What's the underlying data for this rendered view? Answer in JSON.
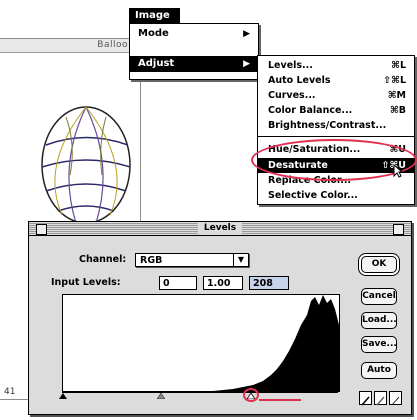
{
  "document": {
    "title": "Balloo",
    "footer": "41"
  },
  "menubar": {
    "image_menu": "Image"
  },
  "image_menu": {
    "items": [
      {
        "label": "Mode",
        "submenu": true
      },
      {
        "label": "Adjust",
        "submenu": true,
        "highlighted": true
      }
    ]
  },
  "adjust_menu": {
    "items": [
      {
        "label": "Levels...",
        "shortcut": "⌘L"
      },
      {
        "label": "Auto Levels",
        "shortcut": "⇧⌘L"
      },
      {
        "label": "Curves...",
        "shortcut": "⌘M"
      },
      {
        "label": "Color Balance...",
        "shortcut": "⌘B"
      },
      {
        "label": "Brightness/Contrast...",
        "shortcut": ""
      },
      {
        "label": "Hue/Saturation...",
        "shortcut": "⌘U"
      },
      {
        "label": "Desaturate",
        "shortcut": "⇧⌘U",
        "highlighted": true
      },
      {
        "label": "Replace Color...",
        "shortcut": ""
      },
      {
        "label": "Selective Color...",
        "shortcut": ""
      }
    ]
  },
  "levels_dialog": {
    "title": "Levels",
    "channel_label": "Channel:",
    "channel_value": "RGB",
    "input_levels_label": "Input Levels:",
    "input_black": "0",
    "input_gamma": "1.00",
    "input_white": "208",
    "buttons": {
      "ok": "OK",
      "cancel": "Cancel",
      "load": "Load...",
      "save": "Save...",
      "auto": "Auto"
    }
  },
  "annotation_color": "#e03050"
}
